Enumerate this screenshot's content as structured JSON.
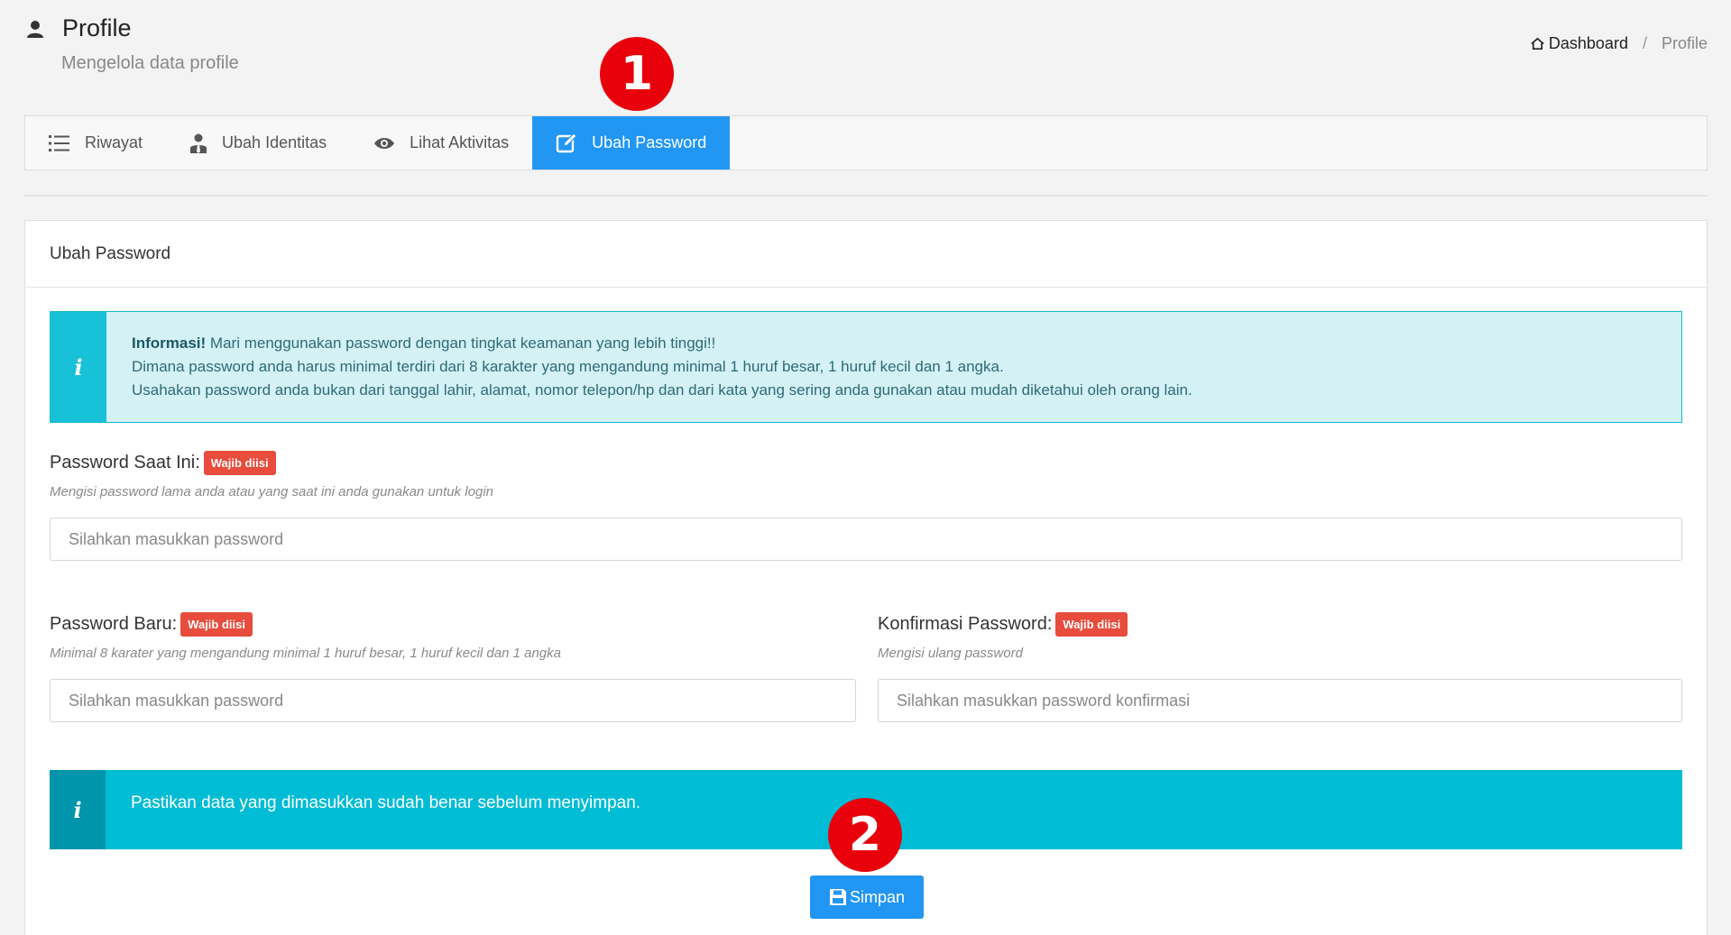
{
  "header": {
    "title": "Profile",
    "subtitle": "Mengelola data profile"
  },
  "breadcrumb": {
    "home": "Dashboard",
    "separator": "/",
    "current": "Profile"
  },
  "tabs": [
    {
      "label": "Riwayat",
      "icon": "list-icon",
      "active": false
    },
    {
      "label": "Ubah Identitas",
      "icon": "user-tie-icon",
      "active": false
    },
    {
      "label": "Lihat Aktivitas",
      "icon": "eye-icon",
      "active": false
    },
    {
      "label": "Ubah Password",
      "icon": "edit-icon",
      "active": true
    }
  ],
  "panel": {
    "title": "Ubah Password",
    "info_alert": {
      "icon": "i",
      "title": "Informasi!",
      "line1": "Mari menggunakan password dengan tingkat keamanan yang lebih tinggi!!",
      "line2": "Dimana password anda harus minimal terdiri dari 8 karakter yang mengandung minimal 1 huruf besar, 1 huruf kecil dan 1 angka.",
      "line3": "Usahakan password anda bukan dari tanggal lahir, alamat, nomor telepon/hp dan dari kata yang sering anda gunakan atau mudah diketahui oleh orang lain."
    },
    "current_password": {
      "label": "Password Saat Ini:",
      "badge": "Wajib diisi",
      "help": "Mengisi password lama anda atau yang saat ini anda gunakan untuk login",
      "placeholder": "Silahkan masukkan password"
    },
    "new_password": {
      "label": "Password Baru:",
      "badge": "Wajib diisi",
      "help": "Minimal 8 karater yang mengandung minimal 1 huruf besar, 1 huruf kecil dan 1 angka",
      "placeholder": "Silahkan masukkan password"
    },
    "confirm_password": {
      "label": "Konfirmasi Password:",
      "badge": "Wajib diisi",
      "help": "Mengisi ulang password",
      "placeholder": "Silahkan masukkan password konfirmasi"
    },
    "confirm_alert": {
      "icon": "i",
      "text": "Pastikan data yang dimasukkan sudah benar sebelum menyimpan."
    },
    "save_label": "Simpan"
  },
  "markers": [
    "1",
    "2"
  ],
  "colors": {
    "primary": "#2196f3",
    "required_badge": "#e74c3c",
    "info": "#17c1d8",
    "marker": "#e8000b"
  }
}
